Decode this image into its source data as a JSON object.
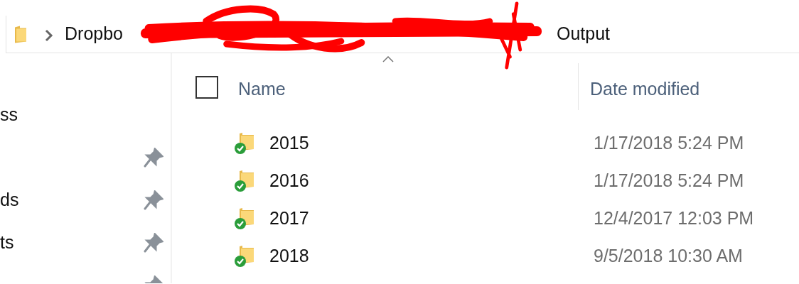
{
  "address_bar": {
    "segments": [
      {
        "kind": "text",
        "text": "Dropbo"
      },
      {
        "kind": "redacted"
      },
      {
        "kind": "text",
        "text": "Output"
      }
    ]
  },
  "sidebar": {
    "items": [
      {
        "label": "ss",
        "pinned": false
      },
      {
        "pinned": true
      },
      {
        "label": "ds",
        "pinned": true
      },
      {
        "label": "ts",
        "pinned": true
      },
      {
        "pinned": true
      }
    ]
  },
  "file_list": {
    "select_all_checked": false,
    "columns": [
      {
        "label": "Name",
        "sort_ascending": true
      },
      {
        "label": "Date modified"
      }
    ],
    "rows": [
      {
        "name": "2015",
        "synced": true,
        "date_modified": "1/17/2018 5:24 PM"
      },
      {
        "name": "2016",
        "synced": true,
        "date_modified": "1/17/2018 5:24 PM"
      },
      {
        "name": "2017",
        "synced": true,
        "date_modified": "12/4/2017 12:03 PM"
      },
      {
        "name": "2018",
        "synced": true,
        "date_modified": "9/5/2018 10:30 AM"
      }
    ]
  }
}
